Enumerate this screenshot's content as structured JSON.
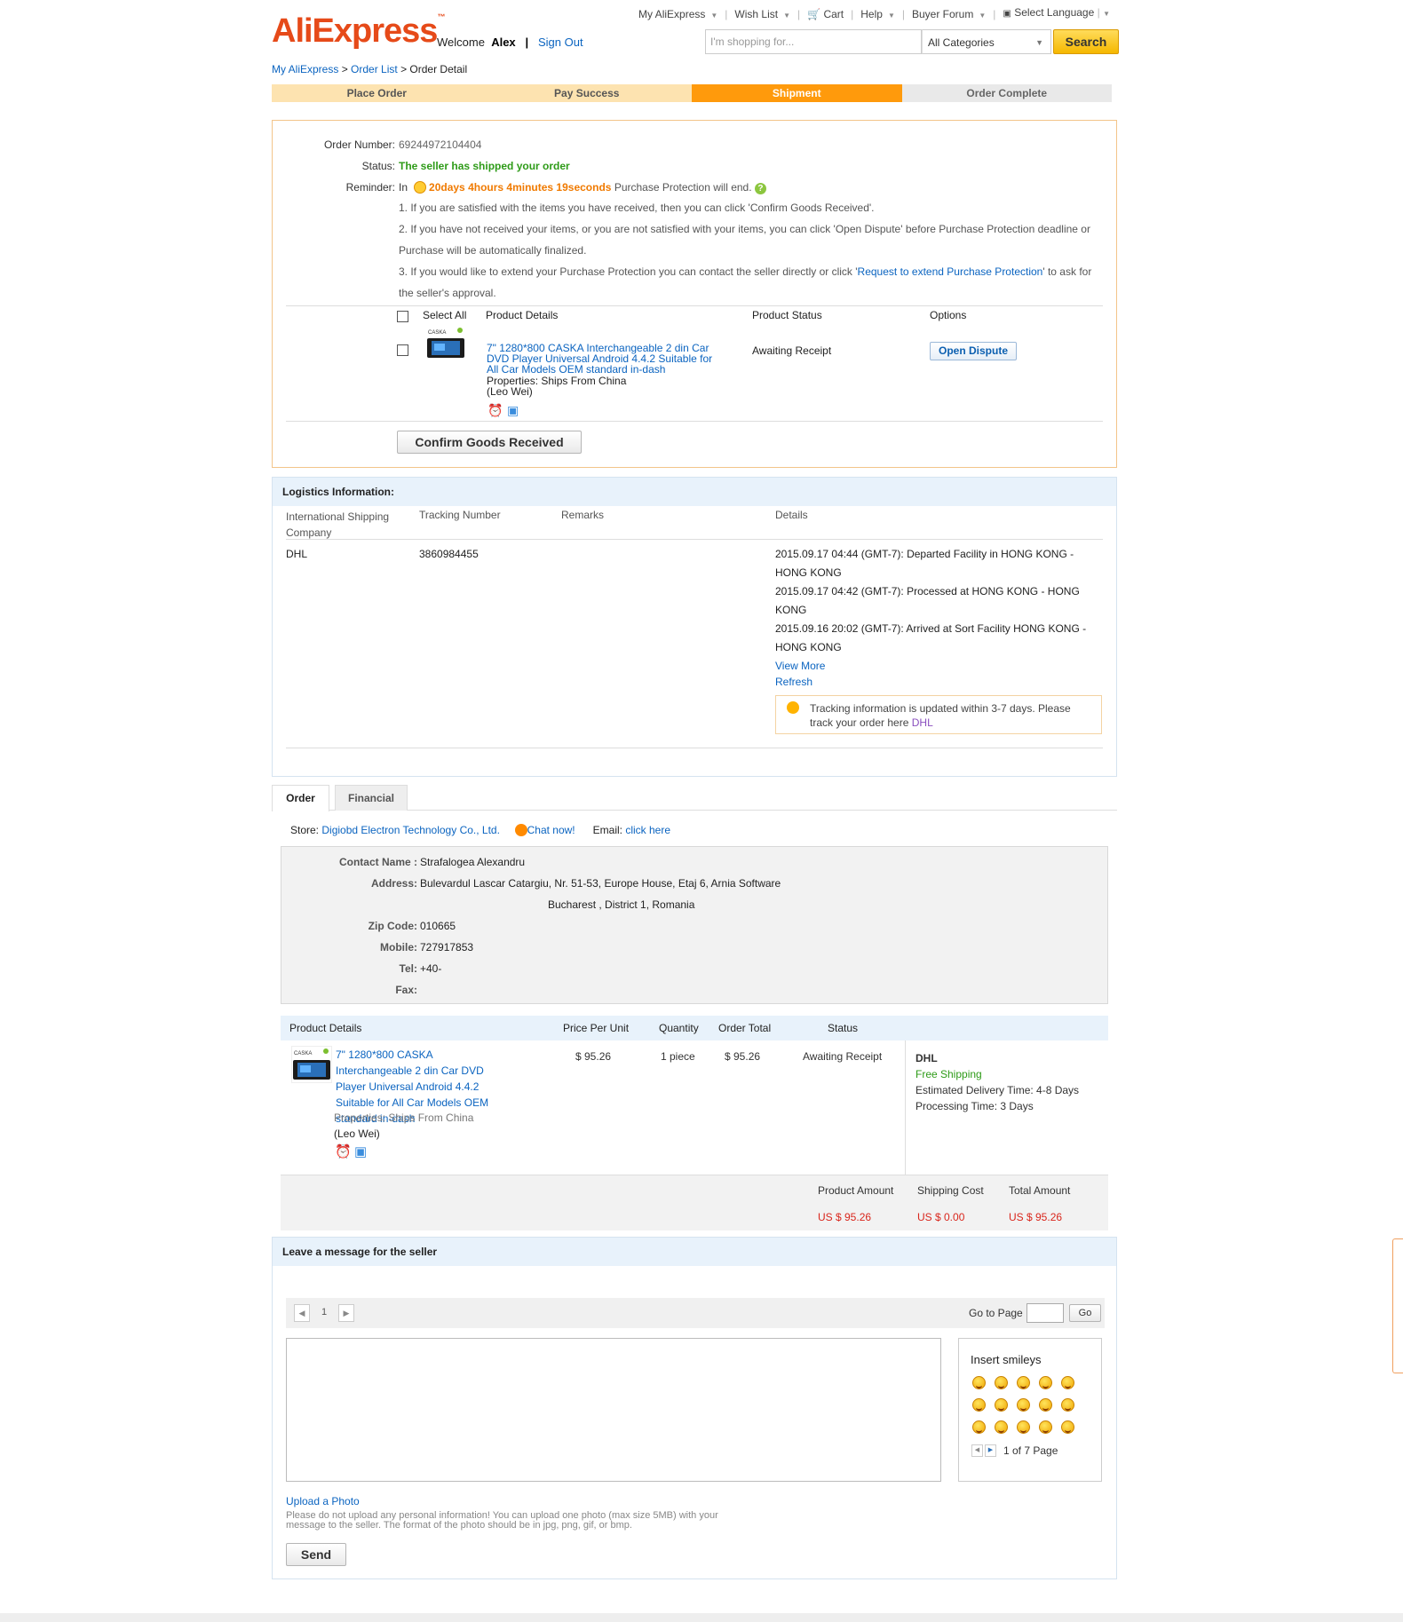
{
  "header": {
    "logo": "AliExpress",
    "welcome_prefix": "Welcome",
    "user": "Alex",
    "sign_out": "Sign Out",
    "nav": [
      "My AliExpress",
      "Wish List",
      "Cart",
      "Help",
      "Buyer Forum"
    ],
    "select_language": "Select Language",
    "search_placeholder": "I'm shopping for...",
    "category": "All Categories",
    "search_button": "Search"
  },
  "breadcrumb": {
    "my": "My AliExpress",
    "list": "Order List",
    "current": "Order Detail"
  },
  "steps": [
    "Place Order",
    "Pay Success",
    "Shipment",
    "Order Complete"
  ],
  "order": {
    "number_label": "Order Number:",
    "number": "69244972104404",
    "status_label": "Status:",
    "status": "The seller has shipped your order",
    "reminder_label": "Reminder:",
    "reminder_in": "In",
    "countdown": "20days 4hours 4minutes 19seconds",
    "reminder_tail": "Purchase Protection will end.",
    "note1": "1. If you are satisfied with the items you have received, then you can click 'Confirm Goods Received'.",
    "note2": "2. If you have not received your items, or you are not satisfied with your items, you can click 'Open Dispute' before Purchase Protection deadline or Purchase will be automatically finalized.",
    "note3_a": "3. If you would like to extend your Purchase Protection you can contact the seller directly or click '",
    "note3_link": "Request to extend Purchase Protection",
    "note3_b": "' to ask for the seller's approval.",
    "col_select_all": "Select All",
    "col_product": "Product Details",
    "col_status": "Product Status",
    "col_options": "Options",
    "product_title": "7\" 1280*800 CASKA Interchangeable 2 din Car DVD Player Universal Android 4.4.2 Suitable for All Car Models OEM standard in-dash",
    "properties": "Properties: Ships From China",
    "seller": "(Leo Wei)",
    "product_status": "Awaiting Receipt",
    "open_dispute": "Open Dispute",
    "confirm_button": "Confirm Goods Received"
  },
  "logistics": {
    "title": "Logistics Information:",
    "col_company": "International Shipping Company",
    "col_tracking": "Tracking Number",
    "col_remarks": "Remarks",
    "col_details": "Details",
    "company": "DHL",
    "tracking": "3860984455",
    "events": [
      "2015.09.17 04:44 (GMT-7): Departed Facility in HONG KONG - HONG KONG",
      "2015.09.17 04:42 (GMT-7): Processed at HONG KONG - HONG KONG",
      "2015.09.16 20:02 (GMT-7): Arrived at Sort Facility HONG KONG - HONG KONG"
    ],
    "view_more": "View More",
    "refresh": "Refresh",
    "tip": "Tracking information is updated within 3-7 days. Please track your order here",
    "tip_link": "DHL"
  },
  "tabs": [
    "Order",
    "Financial"
  ],
  "store": {
    "label": "Store:",
    "name": "Digiobd Electron Technology Co., Ltd.",
    "chat": "Chat now!",
    "email_label": "Email:",
    "email_link": "click here"
  },
  "contact": {
    "name_label": "Contact Name :",
    "name": "Strafalogea Alexandru",
    "address_label": "Address:",
    "address1": "Bulevardul Lascar Catargiu, Nr. 51-53, Europe House, Etaj 6, Arnia Software",
    "address2": "Bucharest , District 1, Romania",
    "zip_label": "Zip Code:",
    "zip": "010665",
    "mobile_label": "Mobile:",
    "mobile": "727917853",
    "tel_label": "Tel:",
    "tel": "+40-",
    "fax_label": "Fax:"
  },
  "products_table": {
    "headers": [
      "Product Details",
      "Price Per Unit",
      "Quantity",
      "Order Total",
      "Status"
    ],
    "title": "7\" 1280*800 CASKA Interchangeable 2 din Car DVD Player Universal Android 4.4.2 Suitable for All Car Models OEM standard in-dash",
    "properties": "Properties: Ships From China",
    "seller": "(Leo Wei)",
    "price": "$ 95.26",
    "quantity": "1 piece",
    "total": "$ 95.26",
    "status": "Awaiting Receipt",
    "carrier": "DHL",
    "free_shipping": "Free Shipping",
    "delivery": "Estimated Delivery Time:  4-8 Days",
    "processing": "Processing Time:  3 Days",
    "product_amount_label": "Product Amount",
    "shipping_cost_label": "Shipping Cost",
    "total_amount_label": "Total Amount",
    "product_amount": "US $ 95.26",
    "shipping_cost": "US $ 0.00",
    "total_amount": "US $ 95.26"
  },
  "message": {
    "title": "Leave a message for the seller",
    "page": "1",
    "go_to_page": "Go to Page",
    "go": "Go",
    "insert_smileys": "Insert smileys",
    "smiley_pages": "1 of 7 Page",
    "upload": "Upload a Photo",
    "upload_note": "Please do not upload any personal information! You can upload one photo (max size 5MB) with your message to the seller. The format of the photo should be in jpg, png, gif, or bmp.",
    "send": "Send"
  },
  "colors": {
    "accent": "#ff9a0c",
    "link": "#0b64c0",
    "status_green": "#2e9b18",
    "price_red": "#d9261c",
    "countdown": "#f07a00"
  }
}
